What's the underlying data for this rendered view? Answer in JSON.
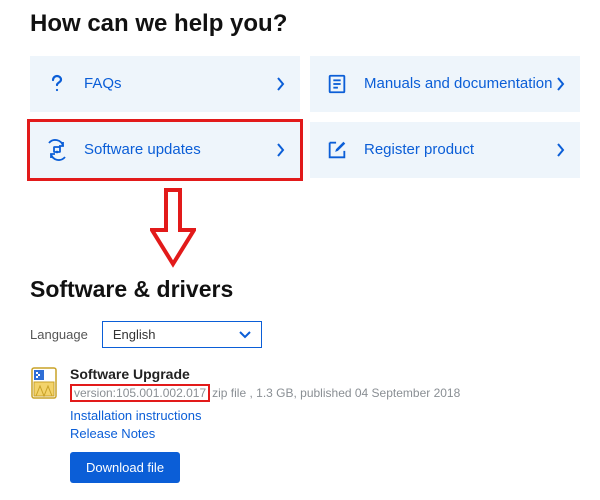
{
  "heading": "How can we help you?",
  "tiles": {
    "faqs": "FAQs",
    "manuals": "Manuals and documentation",
    "software_updates": "Software updates",
    "register": "Register product"
  },
  "section_heading": "Software & drivers",
  "language": {
    "label": "Language",
    "selected": "English"
  },
  "download": {
    "title": "Software Upgrade",
    "version_label": "version:",
    "version_value": "105.001.002.017",
    "file_meta": "zip file , 1.3 GB, published 04 September 2018",
    "install_link": "Installation instructions",
    "release_notes": "Release Notes",
    "button": "Download file"
  },
  "colors": {
    "accent": "#0b5ed7",
    "highlight": "#e21a1a",
    "tile_bg": "#eef5fb"
  }
}
